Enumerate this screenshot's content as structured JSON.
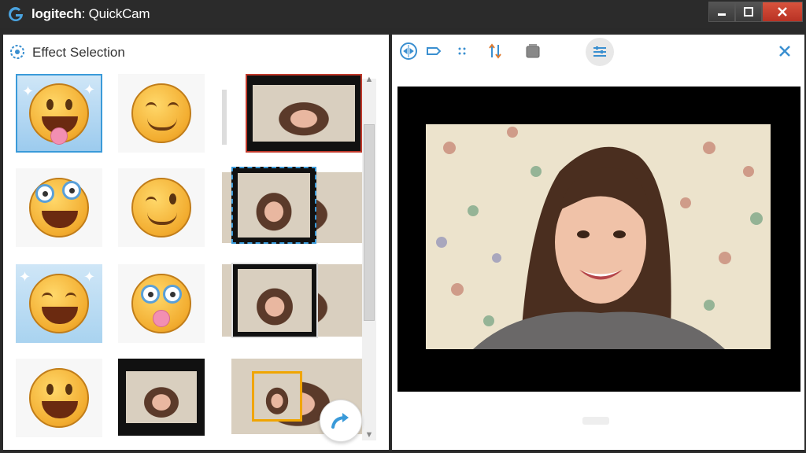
{
  "window": {
    "title_brand": "logitech",
    "title_product": "QuickCam"
  },
  "left": {
    "header": "Effect Selection"
  },
  "colors": {
    "accent": "#3a9ad9",
    "selection_red": "#c0392b",
    "close_red": "#c94330",
    "titlebar": "#2b2b2b"
  },
  "icons": {
    "app": "logitech-g-icon",
    "effects": "gear-icon",
    "next": "arrow-right-icon",
    "close": "close-icon"
  }
}
